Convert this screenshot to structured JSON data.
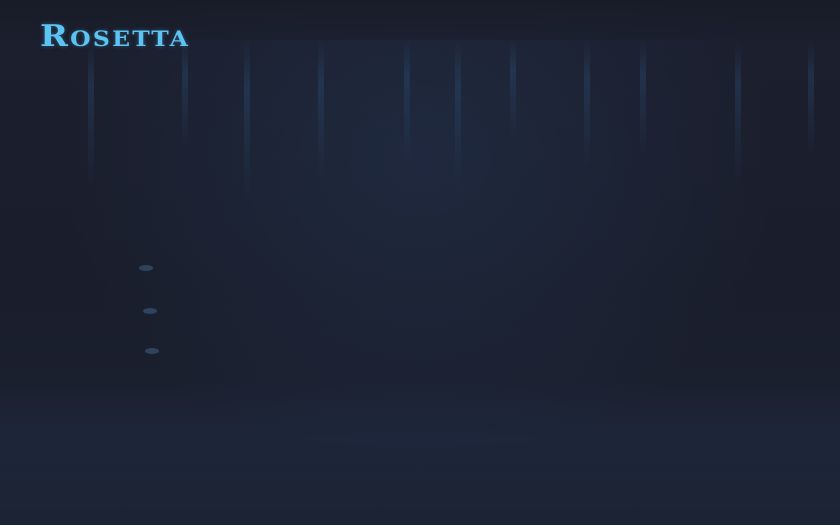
{
  "app": {
    "logo_text": "Rosetta"
  },
  "colors": {
    "background": "#1a1e2c",
    "logo": "#5cc4f2"
  }
}
